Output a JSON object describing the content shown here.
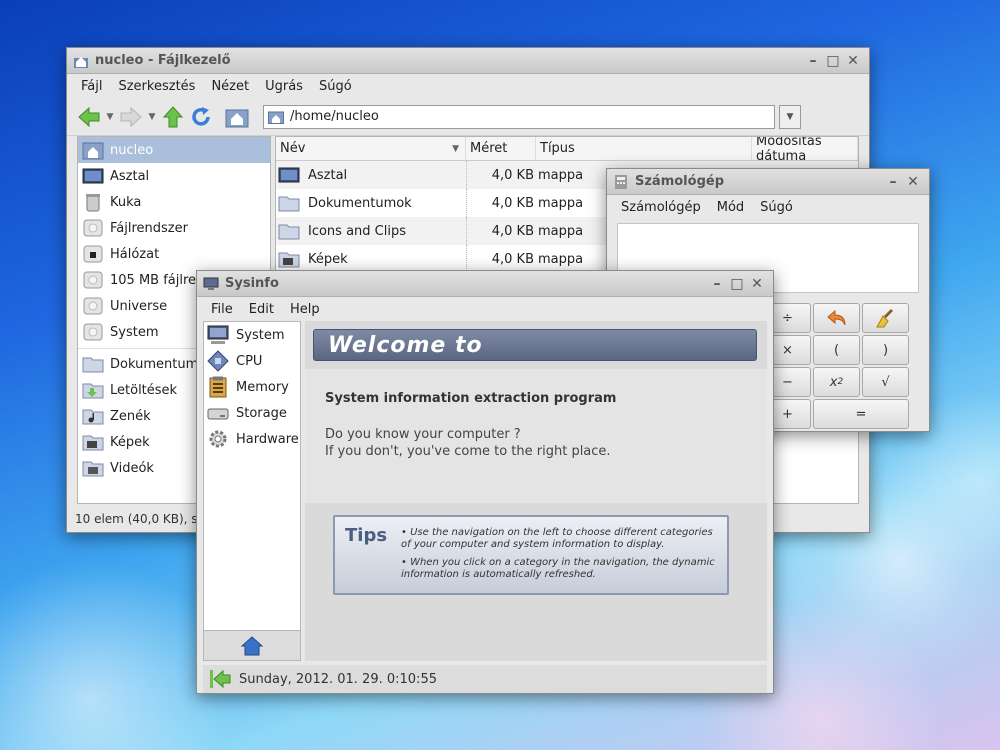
{
  "file_manager": {
    "title": "nucleo - Fájlkezelő",
    "menu": [
      "Fájl",
      "Szerkesztés",
      "Nézet",
      "Ugrás",
      "Súgó"
    ],
    "path": "/home/nucleo",
    "sidebar": [
      {
        "label": "nucleo",
        "icon": "home-folder-icon",
        "selected": true
      },
      {
        "label": "Asztal",
        "icon": "desktop-icon"
      },
      {
        "label": "Kuka",
        "icon": "trash-icon"
      },
      {
        "label": "Fájlrendszer",
        "icon": "drive-icon"
      },
      {
        "label": "Hálózat",
        "icon": "network-icon"
      },
      {
        "label": "105 MB fájlrendszer",
        "icon": "drive-icon"
      },
      {
        "label": "Universe",
        "icon": "drive-icon"
      },
      {
        "label": "System",
        "icon": "drive-icon"
      },
      {
        "label": "Dokumentumok",
        "icon": "folder-icon"
      },
      {
        "label": "Letöltések",
        "icon": "download-folder-icon"
      },
      {
        "label": "Zenék",
        "icon": "music-folder-icon"
      },
      {
        "label": "Képek",
        "icon": "pictures-folder-icon"
      },
      {
        "label": "Videók",
        "icon": "video-folder-icon"
      }
    ],
    "columns": [
      "Név",
      "Méret",
      "Típus",
      "Módosítás dátuma"
    ],
    "files": [
      {
        "name": "Asztal",
        "size": "4,0 KB",
        "type": "mappa"
      },
      {
        "name": "Dokumentumok",
        "size": "4,0 KB",
        "type": "mappa"
      },
      {
        "name": "Icons and Clips",
        "size": "4,0 KB",
        "type": "mappa"
      },
      {
        "name": "Képek",
        "size": "4,0 KB",
        "type": "mappa"
      }
    ],
    "status": "10 elem (40,0 KB), sza"
  },
  "calculator": {
    "title": "Számológép",
    "menu": [
      "Számológép",
      "Mód",
      "Súgó"
    ],
    "buttons": [
      [
        "÷",
        "undo",
        "clear"
      ],
      [
        "×",
        "(",
        ")"
      ],
      [
        "−",
        "x²",
        "√"
      ],
      [
        "+",
        "="
      ]
    ]
  },
  "sysinfo": {
    "title": "Sysinfo",
    "menu": [
      "File",
      "Edit",
      "Help"
    ],
    "nav": [
      "System",
      "CPU",
      "Memory",
      "Storage",
      "Hardware"
    ],
    "welcome": "Welcome to",
    "heading": "System information extraction program",
    "line1": "Do you know your computer ?",
    "line2": "If you don't, you've come to the right place.",
    "tips_title": "Tips",
    "tip1": "Use the navigation on the left to choose different categories of your computer and system information to display.",
    "tip2": "When you click on a category in the navigation, the dynamic information is automatically refreshed.",
    "status": "Sunday, 2012. 01. 29. 0:10:55"
  },
  "colors": {
    "accent": "#5b6683",
    "selection": "#a9bfdc",
    "green_arrow": "#6cc24a"
  }
}
